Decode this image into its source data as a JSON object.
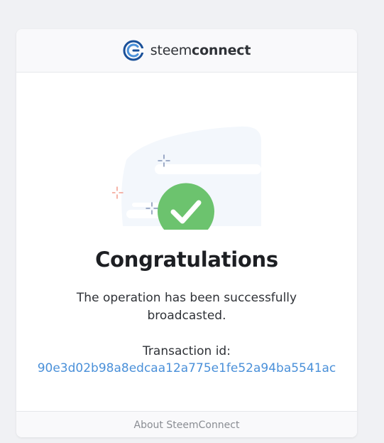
{
  "header": {
    "brand_light": "steem",
    "brand_bold": "connect",
    "logo_icon": "steemconnect-logo-icon"
  },
  "main": {
    "illustration_icon": "success-checkmark-icon",
    "title": "Congratulations",
    "message": "The operation has been successfully broadcasted.",
    "transaction_label": "Transaction id:",
    "transaction_id": "90e3d02b98a8edcaa12a775e1fe52a94ba5541ac"
  },
  "footer": {
    "link_label": "About SteemConnect"
  },
  "colors": {
    "success": "#6cc36e",
    "link": "#4a90d9",
    "brand": "#1a5099"
  }
}
